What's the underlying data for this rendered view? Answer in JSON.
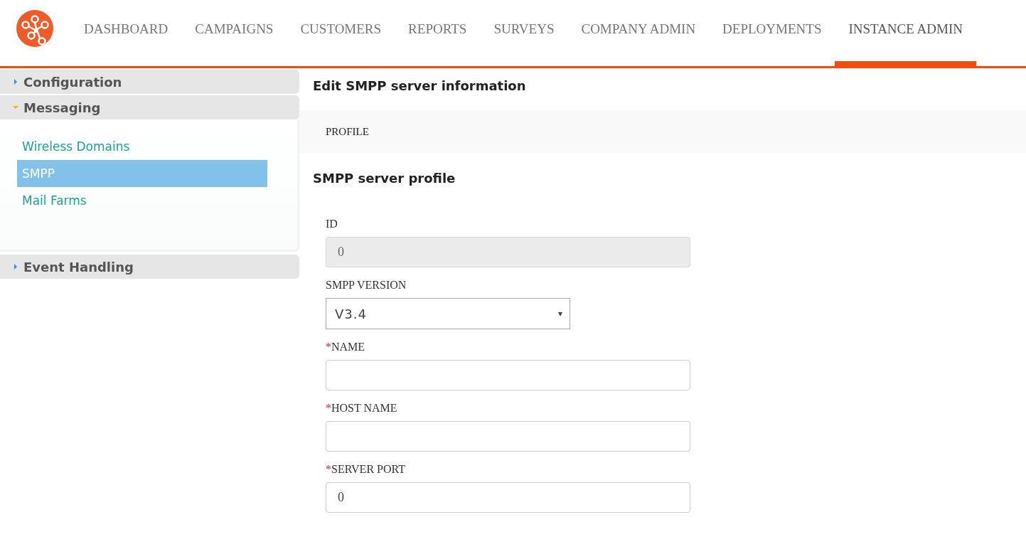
{
  "nav": {
    "tabs": [
      {
        "label": "DASHBOARD",
        "selected": false
      },
      {
        "label": "CAMPAIGNS",
        "selected": false
      },
      {
        "label": "CUSTOMERS",
        "selected": false
      },
      {
        "label": "REPORTS",
        "selected": false
      },
      {
        "label": "SURVEYS",
        "selected": false
      },
      {
        "label": "COMPANY ADMIN",
        "selected": false
      },
      {
        "label": "DEPLOYMENTS",
        "selected": false
      },
      {
        "label": "INSTANCE ADMIN",
        "selected": true
      }
    ]
  },
  "sidebar": {
    "sections": [
      {
        "label": "Configuration",
        "expanded": false
      },
      {
        "label": "Messaging",
        "expanded": true,
        "items": [
          {
            "label": "Wireless Domains",
            "selected": false
          },
          {
            "label": "SMPP",
            "selected": true
          },
          {
            "label": "Mail Farms",
            "selected": false
          }
        ]
      },
      {
        "label": "Event Handling",
        "expanded": false
      }
    ]
  },
  "main": {
    "title": "Edit SMPP server information",
    "tab_label": "PROFILE",
    "section_title": "SMPP server profile",
    "fields": [
      {
        "kind": "text",
        "label": "ID",
        "required": false,
        "disabled": true,
        "value": "0"
      },
      {
        "kind": "select",
        "label": "SMPP VERSION",
        "required": false,
        "value": "V3.4",
        "caret": "▾"
      },
      {
        "kind": "text",
        "label": "NAME",
        "required": true,
        "disabled": false
      },
      {
        "kind": "text",
        "label": "HOST NAME",
        "required": true,
        "disabled": false
      },
      {
        "kind": "text",
        "label": "SERVER PORT",
        "required": true,
        "disabled": false,
        "value": "0"
      }
    ],
    "required_mark": "*"
  }
}
